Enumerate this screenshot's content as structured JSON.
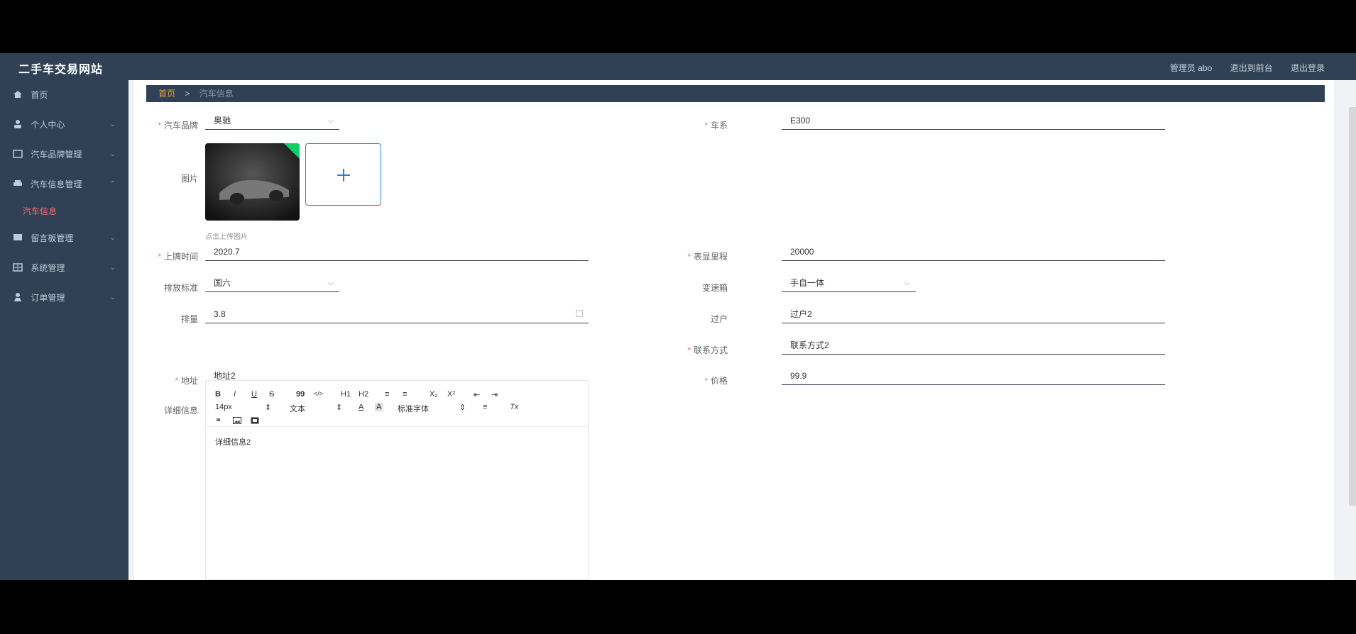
{
  "app": {
    "title": "二手车交易网站"
  },
  "top_links": [
    "管理员 abo",
    "退出到前台",
    "退出登录"
  ],
  "sidebar": {
    "items": [
      {
        "label": "首页",
        "icon": "home-icon"
      },
      {
        "label": "个人中心",
        "icon": "user-icon"
      },
      {
        "label": "汽车品牌管理",
        "icon": "brand-icon"
      },
      {
        "label": "汽车信息管理",
        "icon": "car-icon"
      },
      {
        "label": "留言板管理",
        "icon": "message-icon"
      },
      {
        "label": "系统管理",
        "icon": "grid-icon"
      },
      {
        "label": "订单管理",
        "icon": "order-icon"
      }
    ],
    "active_sub": "汽车信息"
  },
  "breadcrumb": {
    "home": "首页",
    "separator": ">",
    "current": "汽车信息"
  },
  "form": {
    "brand": {
      "label": "汽车品牌",
      "value": "奥驰"
    },
    "series": {
      "label": "车系",
      "value": "E300"
    },
    "image": {
      "label": "图片",
      "hint": "点击上传图片"
    },
    "reg_time": {
      "label": "上牌时间",
      "value": "2020.7"
    },
    "mileage": {
      "label": "表显里程",
      "value": "20000"
    },
    "emission": {
      "label": "排放标准",
      "value": "国六"
    },
    "gearbox": {
      "label": "变速箱",
      "value": "手自一体"
    },
    "displacement": {
      "label": "排量",
      "value": "3.8"
    },
    "transfer": {
      "label": "过户",
      "value": "过户2"
    },
    "contact": {
      "label": "联系方式",
      "value": "联系方式2"
    },
    "address": {
      "label": "地址",
      "value": "地址2"
    },
    "price": {
      "label": "价格",
      "value": "99.9"
    },
    "details": {
      "label": "详细信息",
      "content": "详细信息2",
      "toolbar": {
        "bold": "B",
        "italic": "I",
        "underline": "U",
        "strike": "S",
        "quote": "99",
        "code": "</>",
        "h1": "H1",
        "h2": "H2",
        "ol": "≡",
        "ul": "≡",
        "sub": "X₂",
        "sup": "X²",
        "indent_left": "⇤",
        "indent_right": "⇥",
        "size": "14px",
        "header": "文本",
        "color": "A",
        "bg": "A",
        "font": "标准字体",
        "align": "≡",
        "clean": "Tx"
      }
    }
  },
  "colors": {
    "sidebar": "#304156",
    "accent": "#409eff",
    "required": "#f56c6c",
    "active_menu": "#f56c6c"
  }
}
